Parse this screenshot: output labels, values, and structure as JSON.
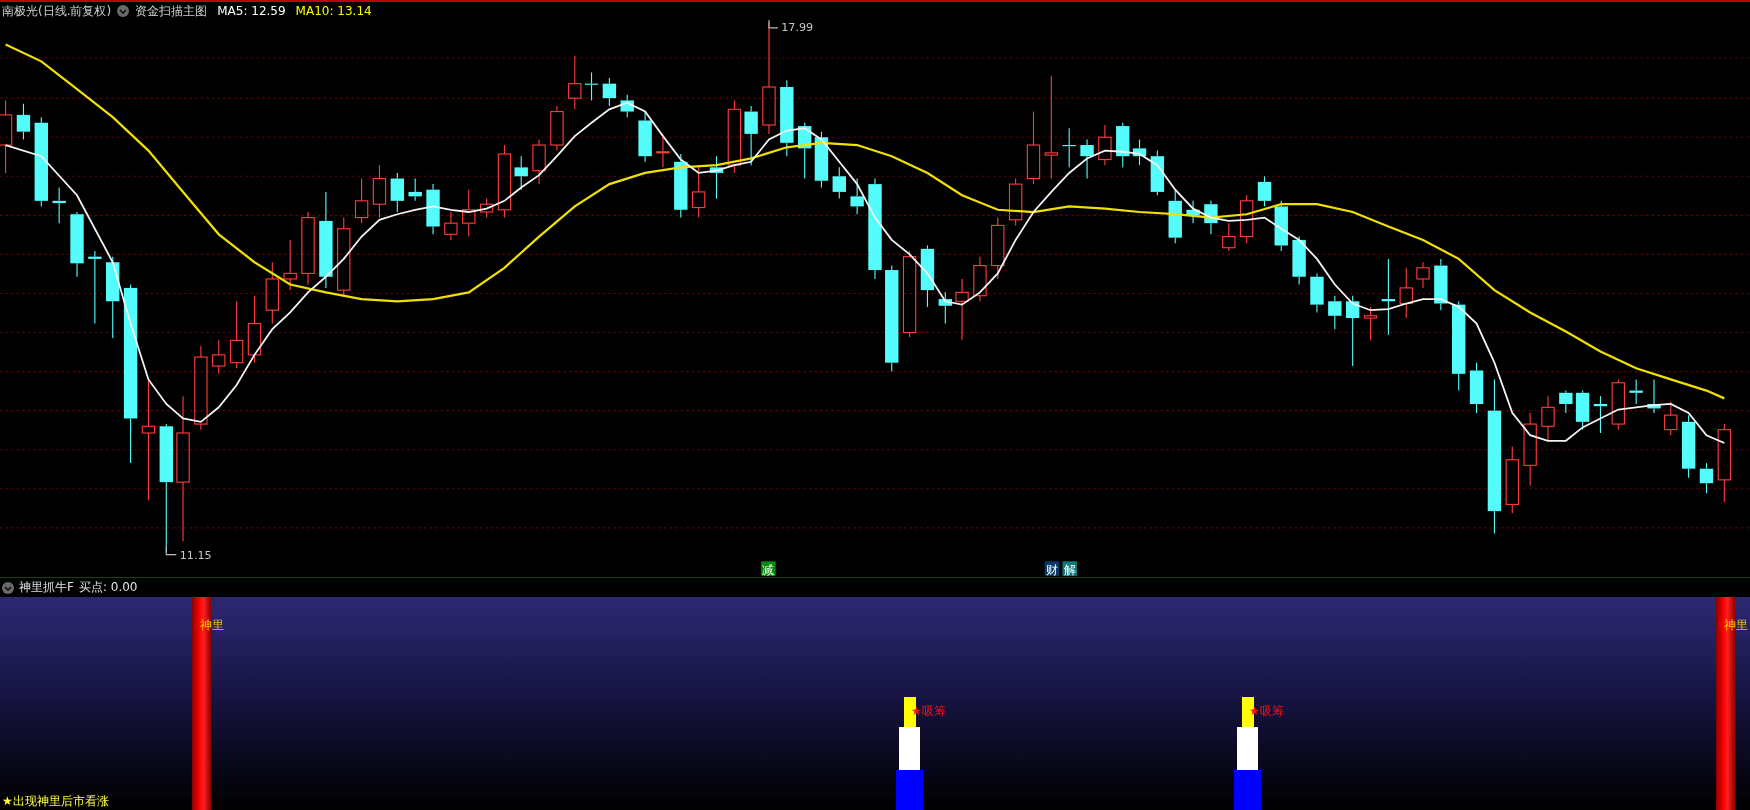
{
  "header": {
    "title": "南极光(日线.前复权)",
    "indicator": "资金扫描主图",
    "ma5": "MA5: 12.59",
    "ma10": "MA10: 13.14"
  },
  "price_chart": {
    "high_label": "17.99",
    "low_label": "11.15",
    "badges": [
      {
        "text": "减",
        "color": "#0a8a0a"
      },
      {
        "text": "财",
        "color": "#0a3a6a"
      },
      {
        "text": "解",
        "color": "#0a7a7a"
      }
    ]
  },
  "indicator_panel": {
    "title": "神里抓牛F",
    "buy_point": "买点: 0.00",
    "markers": [
      {
        "label": "神里"
      },
      {
        "label": "神里"
      }
    ],
    "signals": [
      {
        "label": "★吸筹"
      },
      {
        "label": "★吸筹"
      }
    ],
    "note": "★出现神里后市看涨"
  }
}
